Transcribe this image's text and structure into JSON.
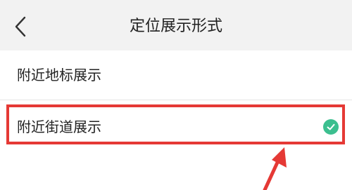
{
  "header": {
    "back_icon": "chevron-left-icon",
    "title": "定位展示形式"
  },
  "options": [
    {
      "label": "附近地标展示",
      "selected": false
    },
    {
      "label": "附近街道展示",
      "selected": true
    }
  ],
  "colors": {
    "highlight_border": "#e53935",
    "check_circle": "#3cbf8f",
    "annotation_arrow": "#e53935"
  }
}
